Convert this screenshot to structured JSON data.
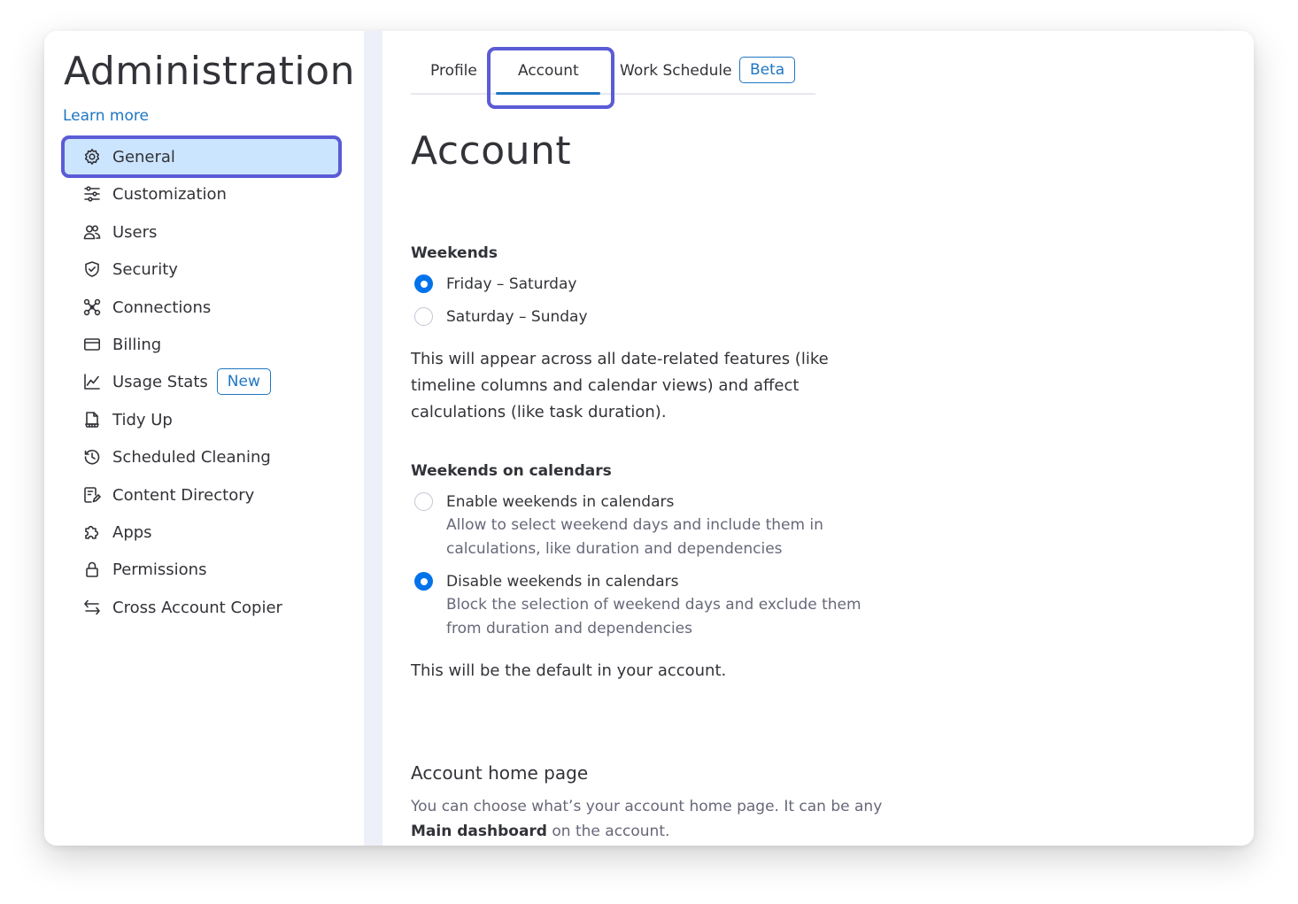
{
  "sidebar": {
    "title": "Administration",
    "learn_more": "Learn more",
    "items": [
      {
        "label": "General",
        "icon": "gear-icon"
      },
      {
        "label": "Customization",
        "icon": "sliders-icon"
      },
      {
        "label": "Users",
        "icon": "users-icon"
      },
      {
        "label": "Security",
        "icon": "shield-icon"
      },
      {
        "label": "Connections",
        "icon": "connections-icon"
      },
      {
        "label": "Billing",
        "icon": "credit-card-icon"
      },
      {
        "label": "Usage Stats",
        "icon": "chart-line-icon",
        "badge": "New"
      },
      {
        "label": "Tidy Up",
        "icon": "tidy-up-icon"
      },
      {
        "label": "Scheduled Cleaning",
        "icon": "clock-history-icon"
      },
      {
        "label": "Content Directory",
        "icon": "content-directory-icon"
      },
      {
        "label": "Apps",
        "icon": "puzzle-icon"
      },
      {
        "label": "Permissions",
        "icon": "lock-icon"
      },
      {
        "label": "Cross Account Copier",
        "icon": "swap-arrows-icon"
      }
    ],
    "active_item": "General"
  },
  "tabs": [
    {
      "label": "Profile"
    },
    {
      "label": "Account"
    },
    {
      "label": "Work Schedule",
      "badge": "Beta"
    }
  ],
  "active_tab": "Account",
  "main": {
    "title": "Account",
    "weekends": {
      "label": "Weekends",
      "options": [
        {
          "label": "Friday – Saturday",
          "checked": true
        },
        {
          "label": "Saturday – Sunday",
          "checked": false
        }
      ],
      "note": "This will appear across all date-related features (like timeline columns and calendar views) and affect calculations (like task duration)."
    },
    "weekends_calendars": {
      "label": "Weekends on calendars",
      "options": [
        {
          "label": "Enable weekends in calendars",
          "desc": "Allow to select weekend days and include them in calculations, like duration and dependencies",
          "checked": false
        },
        {
          "label": "Disable weekends in calendars",
          "desc": "Block the selection of weekend days and exclude them from duration and dependencies",
          "checked": true
        }
      ],
      "note": "This will be the default in your account."
    },
    "home_page": {
      "title": "Account home page",
      "desc_prefix": "You can choose what’s your account home page. It can be any",
      "desc_bold": "Main dashboard",
      "desc_suffix": "on the account."
    }
  },
  "colors": {
    "accent_blue": "#0073ea",
    "link_blue": "#1f76c2",
    "active_bg": "#cce5ff",
    "highlight_outline": "#5b5bd6",
    "divider": "#eef0f9"
  }
}
